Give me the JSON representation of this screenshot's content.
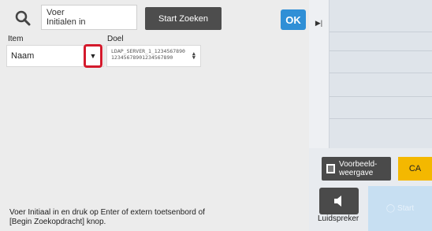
{
  "search": {
    "input_value": "Voer\nInitialen in",
    "start_label": "Start Zoeken",
    "ok_label": "OK"
  },
  "columns": {
    "item_label": "Item",
    "target_label": "Doel"
  },
  "item_field": {
    "value": "Naam"
  },
  "target_field": {
    "line1": "LDAP_SERVER_1_1234567890",
    "line2": "12345678901234567890"
  },
  "footer": {
    "instruction": "Voer Initiaal in en druk op Enter of extern toetsenbord of [Begin Zoekopdracht] knop."
  },
  "right_panel": {
    "preview_label": "Voorbeeld-\nweergave",
    "ca_label": "CA",
    "speaker_label": "Luidspreker",
    "start_label": "Start"
  },
  "colors": {
    "ok_blue": "#2f8fd6",
    "highlight_red": "#d41a2c",
    "ca_yellow": "#f4b800",
    "start_disabled": "#c7dff2"
  }
}
